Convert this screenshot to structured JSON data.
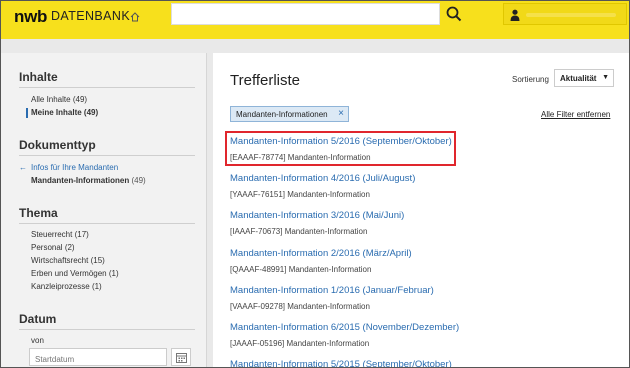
{
  "header": {
    "logo": "nwb",
    "logo_sub": "DATENBANK",
    "search_placeholder": ""
  },
  "sidebar": {
    "inhalte": {
      "title": "Inhalte",
      "items": [
        {
          "label": "Alle Inhalte",
          "count": "(49)"
        },
        {
          "label": "Meine Inhalte",
          "count": "(49)"
        }
      ]
    },
    "dokumenttyp": {
      "title": "Dokumenttyp",
      "back_link": "Infos für Ihre Mandanten",
      "selected": {
        "label": "Mandanten-Informationen",
        "count": "(49)"
      }
    },
    "thema": {
      "title": "Thema",
      "items": [
        {
          "label": "Steuerrecht",
          "count": "(17)"
        },
        {
          "label": "Personal",
          "count": "(2)"
        },
        {
          "label": "Wirtschaftsrecht",
          "count": "(15)"
        },
        {
          "label": "Erben und Vermögen",
          "count": "(1)"
        },
        {
          "label": "Kanzleiprozesse",
          "count": "(1)"
        }
      ]
    },
    "datum": {
      "title": "Datum",
      "von_label": "von",
      "start_placeholder": "Startdatum"
    }
  },
  "main": {
    "title": "Trefferliste",
    "sort_label": "Sortierung",
    "sort_value": "Aktualität",
    "filter_chip": "Mandanten-Informationen",
    "clear_filters": "Alle Filter entfernen",
    "results": [
      {
        "title": "Mandanten-Information 5/2016 (September/Oktober)",
        "meta": "[EAAAF-78774] Mandanten-Information"
      },
      {
        "title": "Mandanten-Information 4/2016 (Juli/August)",
        "meta": "[YAAAF-76151] Mandanten-Information"
      },
      {
        "title": "Mandanten-Information 3/2016 (Mai/Juni)",
        "meta": "[IAAAF-70673] Mandanten-Information"
      },
      {
        "title": "Mandanten-Information 2/2016 (März/April)",
        "meta": "[QAAAF-48991] Mandanten-Information"
      },
      {
        "title": "Mandanten-Information 1/2016 (Januar/Februar)",
        "meta": "[VAAAF-09278] Mandanten-Information"
      },
      {
        "title": "Mandanten-Information 6/2015 (November/Dezember)",
        "meta": "[JAAAF-05196] Mandanten-Information"
      },
      {
        "title": "Mandanten-Information 5/2015 (September/Oktober)",
        "meta": ""
      }
    ]
  },
  "colors": {
    "brand_yellow": "#f7e01c",
    "link_blue": "#2a6cb0",
    "highlight_red": "#e0262d"
  }
}
